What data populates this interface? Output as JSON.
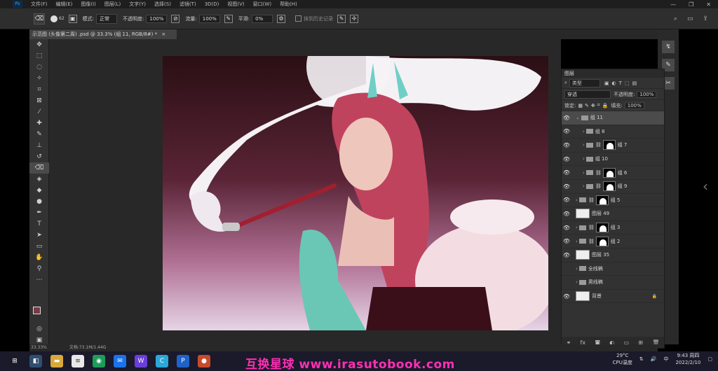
{
  "menubar": {
    "app_icon": "Ps",
    "items": [
      "文件(F)",
      "编辑(E)",
      "图像(I)",
      "图层(L)",
      "文字(Y)",
      "选择(S)",
      "滤镜(T)",
      "3D(D)",
      "视图(V)",
      "窗口(W)",
      "帮助(H)"
    ],
    "window_controls": [
      "minimize-icon",
      "restore-icon",
      "close-icon"
    ]
  },
  "options": {
    "brush_size": "62",
    "mode_label": "模式:",
    "mode_value": "正常",
    "opacity_label": "不透明度:",
    "opacity_value": "100%",
    "flow_label": "流量:",
    "flow_value": "100%",
    "smooth_label": "平滑:",
    "smooth_value": "0%",
    "erase_history": "抹到历史记录"
  },
  "document": {
    "tab_title": "示范图 (头像第二周) .psd @ 33.3% (组 11, RGB/8#) *",
    "zoom": "33.33%",
    "doc_info": "文档:73.1M/1.44G"
  },
  "toolbar": {
    "fg_color": "#7a3a45",
    "bg_color": "#ffffff"
  },
  "layers": {
    "title": "图层",
    "filter_label": "类型",
    "blend_mode": "穿透",
    "opacity_label": "不透明度:",
    "opacity_value": "100%",
    "lock_label": "锁定:",
    "fill_label": "填充:",
    "fill_value": "100%",
    "rows": [
      {
        "name": "组 11",
        "indent": 0,
        "kind": "group",
        "visible": true,
        "selected": true,
        "mask": false
      },
      {
        "name": "组 8",
        "indent": 1,
        "kind": "group",
        "visible": true,
        "selected": false,
        "mask": false
      },
      {
        "name": "组 7",
        "indent": 1,
        "kind": "group",
        "visible": true,
        "selected": false,
        "mask": true
      },
      {
        "name": "组 10",
        "indent": 1,
        "kind": "group",
        "visible": true,
        "selected": false,
        "mask": false
      },
      {
        "name": "组 6",
        "indent": 1,
        "kind": "group",
        "visible": true,
        "selected": false,
        "mask": true
      },
      {
        "name": "组 9",
        "indent": 1,
        "kind": "group",
        "visible": true,
        "selected": false,
        "mask": true
      },
      {
        "name": "组 5",
        "indent": 0,
        "kind": "group",
        "visible": true,
        "selected": false,
        "mask": true
      },
      {
        "name": "图层 49",
        "indent": 0,
        "kind": "layer",
        "visible": true,
        "selected": false,
        "mask": false
      },
      {
        "name": "组 3",
        "indent": 0,
        "kind": "group",
        "visible": true,
        "selected": false,
        "mask": true
      },
      {
        "name": "组 2",
        "indent": 0,
        "kind": "group",
        "visible": true,
        "selected": false,
        "mask": true
      },
      {
        "name": "图层 35",
        "indent": 0,
        "kind": "layer",
        "visible": true,
        "selected": false,
        "mask": false
      },
      {
        "name": "全线稿",
        "indent": 0,
        "kind": "group",
        "visible": false,
        "selected": false,
        "mask": false
      },
      {
        "name": "男线稿",
        "indent": 0,
        "kind": "group",
        "visible": false,
        "selected": false,
        "mask": false
      },
      {
        "name": "背景",
        "indent": 0,
        "kind": "background",
        "visible": true,
        "selected": false,
        "mask": false
      }
    ]
  },
  "taskbar": {
    "watermark": "互换星球 www.irasutobook.com",
    "cpu_label": "CPU温度",
    "cpu_value": "29°C",
    "time": "9:43 周四",
    "date": "2022/2/10"
  }
}
